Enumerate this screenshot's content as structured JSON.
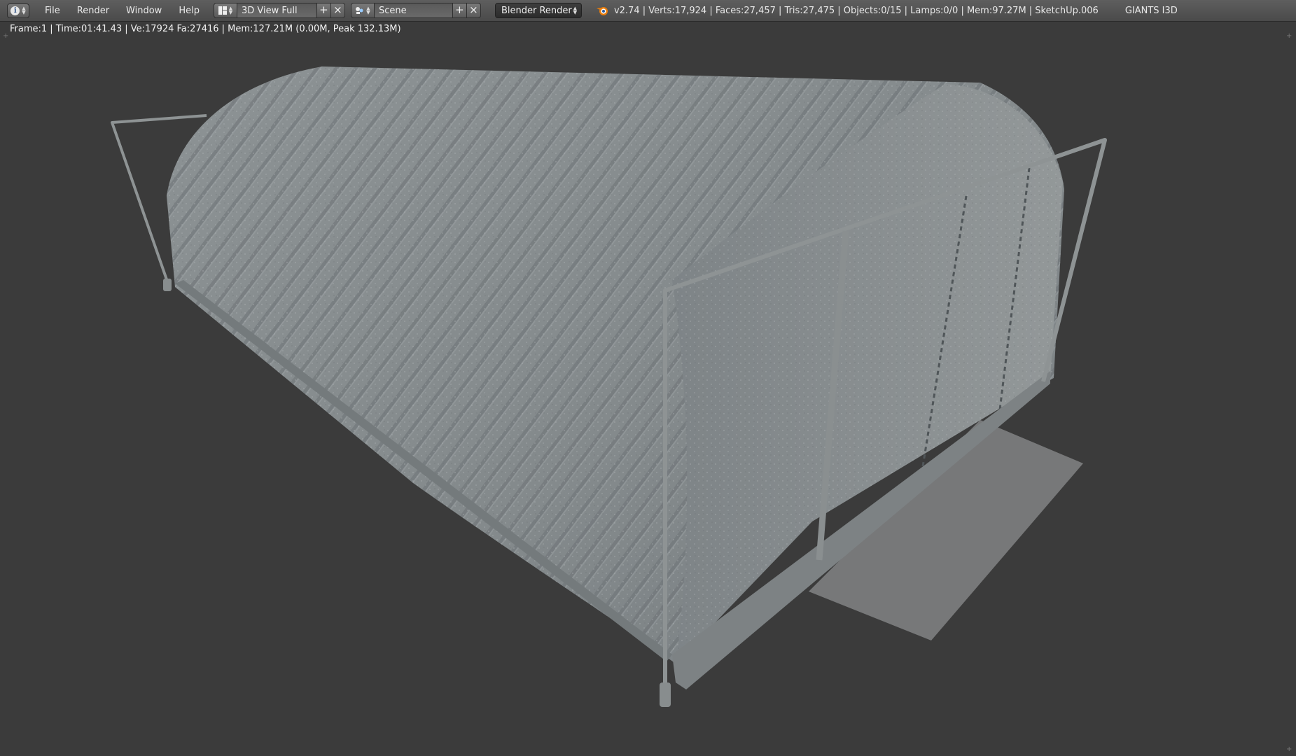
{
  "header": {
    "editor_type_icon": "info-icon",
    "menu": [
      "File",
      "Render",
      "Window",
      "Help"
    ],
    "screen_layout": {
      "icon": "layout-grid-icon",
      "value": "3D View Full",
      "add": "+",
      "remove": "×"
    },
    "scene": {
      "icon": "scene-icon",
      "value": "Scene",
      "add": "+",
      "remove": "×"
    },
    "render_engine": "Blender Render",
    "stats": "v2.74 | Verts:17,924 | Faces:27,457 | Tris:27,475 | Objects:0/15 | Lamps:0/0 | Mem:97.27M | SketchUp.006",
    "addon_label": "GIANTS I3D"
  },
  "viewport": {
    "render_info": "Frame:1 | Time:01:41.43 | Ve:17924 Fa:27416 | Mem:127.21M (0.00M, Peak 132.13M)",
    "content": "quonset-hut-3d-model",
    "colors": {
      "background": "#3b3b3b",
      "roof": "#8a9093",
      "frame": "#909596",
      "floor": "#7a7b7b"
    }
  }
}
